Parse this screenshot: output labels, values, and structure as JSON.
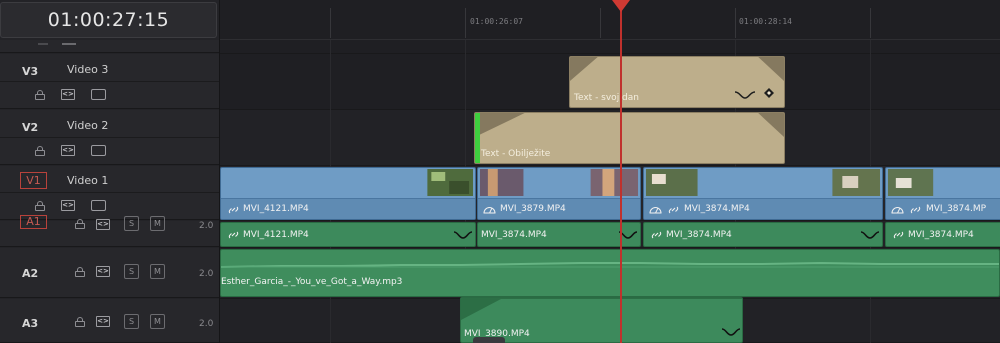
{
  "timecode": "01:00:27:15",
  "ruler": {
    "labels": [
      "01:00:26:07",
      "01:00:28:14"
    ]
  },
  "tracks": {
    "v3": {
      "id": "V3",
      "name": "Video 3"
    },
    "v2": {
      "id": "V2",
      "name": "Video 2"
    },
    "v1": {
      "id": "V1",
      "name": "Video 1"
    },
    "a1": {
      "id": "A1",
      "level": "2.0"
    },
    "a2": {
      "id": "A2",
      "level": "2.0"
    },
    "a3": {
      "id": "A3",
      "level": "2.0"
    }
  },
  "buttons": {
    "solo": "S",
    "mute": "M"
  },
  "clips": {
    "v3_title": "Text - svoj dan",
    "v2_title": "Text - Obilježite",
    "v1": [
      "MVI_4121.MP4",
      "MVI_3879.MP4",
      "MVI_3874.MP4",
      "MVI_3874.MP"
    ],
    "a1": [
      "MVI_4121.MP4",
      "MVI_3874.MP4",
      "MVI_3874.MP4",
      "MVI_3874.MP4"
    ],
    "a2": "Esther_Garcia_-_You_ve_Got_a_Way.mp3",
    "a3": "MVI_3890.MP4"
  },
  "icons": {
    "lock": "lock-icon",
    "auto_select": "auto-select-icon",
    "monitor": "monitor-icon",
    "link": "link-icon",
    "speed": "speed-change-icon",
    "keyframe_curve": "keyframe-curve-icon",
    "keyframe": "keyframe-diamond-icon"
  },
  "colors": {
    "playhead": "#d03a33",
    "video_clip": "#6f9cc5",
    "audio_clip": "#3d8a5c",
    "title_clip": "#b7a886",
    "transition": "#3ecf3e"
  }
}
